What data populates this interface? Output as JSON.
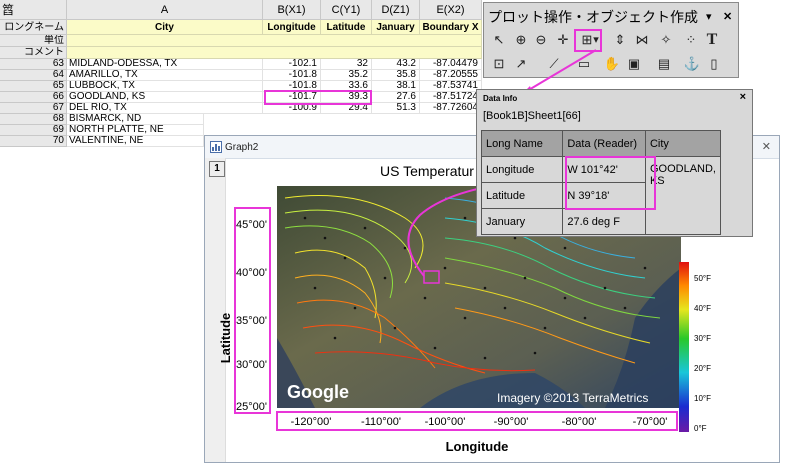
{
  "worksheet": {
    "corner_label": "䈱",
    "columns": [
      {
        "header": "A",
        "long_name": "City"
      },
      {
        "header": "B(X1)",
        "long_name": "Longitude"
      },
      {
        "header": "C(Y1)",
        "long_name": "Latitude"
      },
      {
        "header": "D(Z1)",
        "long_name": "January"
      },
      {
        "header": "E(X2)",
        "long_name": "Boundary X"
      }
    ],
    "meta_labels": [
      "ロングネーム",
      "単位",
      "コメント"
    ],
    "rows": [
      {
        "num": "63",
        "city": "MIDLAND-ODESSA, TX",
        "lon": "-102.1",
        "lat": "32",
        "jan": "43.2",
        "bx": "-87.04479"
      },
      {
        "num": "64",
        "city": "AMARILLO, TX",
        "lon": "-101.8",
        "lat": "35.2",
        "jan": "35.8",
        "bx": "-87.20555"
      },
      {
        "num": "65",
        "city": "LUBBOCK, TX",
        "lon": "-101.8",
        "lat": "33.6",
        "jan": "38.1",
        "bx": "-87.53741"
      },
      {
        "num": "66",
        "city": "GOODLAND, KS",
        "lon": "-101.7",
        "lat": "39.3",
        "jan": "27.6",
        "bx": "-87.51724"
      },
      {
        "num": "67",
        "city": "DEL RIO, TX",
        "lon": "-100.9",
        "lat": "29.4",
        "jan": "51.3",
        "bx": "-87.72604"
      },
      {
        "num": "68",
        "city": "BISMARCK, ND",
        "lon": "",
        "lat": "",
        "jan": "",
        "bx": ""
      },
      {
        "num": "69",
        "city": "NORTH PLATTE, NE",
        "lon": "",
        "lat": "",
        "jan": "",
        "bx": ""
      },
      {
        "num": "70",
        "city": "VALENTINE, NE",
        "lon": "",
        "lat": "",
        "jan": "",
        "bx": ""
      }
    ]
  },
  "graph_window": {
    "title": "Graph2",
    "layer_number": "1",
    "plot_title": "US Temperatur",
    "x_axis_title": "Longitude",
    "y_axis_title": "Latitude",
    "x_ticks": [
      "-120°00'",
      "-110°00'",
      "-100°00'",
      "-90°00'",
      "-80°00'",
      "-70°00'"
    ],
    "y_ticks": [
      "45°00'",
      "40°00'",
      "35°00'",
      "30°00'",
      "25°00'"
    ],
    "colorbar_ticks": [
      "50°F",
      "40°F",
      "30°F",
      "20°F",
      "10°F",
      "0°F"
    ],
    "map_logo": "Google",
    "map_credit": "Imagery ©2013 TerraMetrics"
  },
  "toolbar": {
    "title": "プロット操作・オブジェクト作成",
    "menu_icon": "▾",
    "close_icon": "✕"
  },
  "data_info": {
    "title": "Data Info",
    "close": "×",
    "book": "[Book1B]Sheet1[66]",
    "headers": [
      "Long Name",
      "Data (Reader)",
      "City"
    ],
    "rows": [
      {
        "name": "Longitude",
        "value": "W 101°42'",
        "city": "GOODLAND, KS"
      },
      {
        "name": "Latitude",
        "value": "N 39°18'",
        "city": ""
      },
      {
        "name": "January",
        "value": "27.6 deg F",
        "city": ""
      }
    ]
  },
  "colors": {
    "highlight": "#e835d8",
    "meta_row": "#fbfbc8",
    "header_bg": "#e8e8e8",
    "data_info_bg": "#d8d8d8",
    "data_info_header": "#a3a3a3"
  }
}
